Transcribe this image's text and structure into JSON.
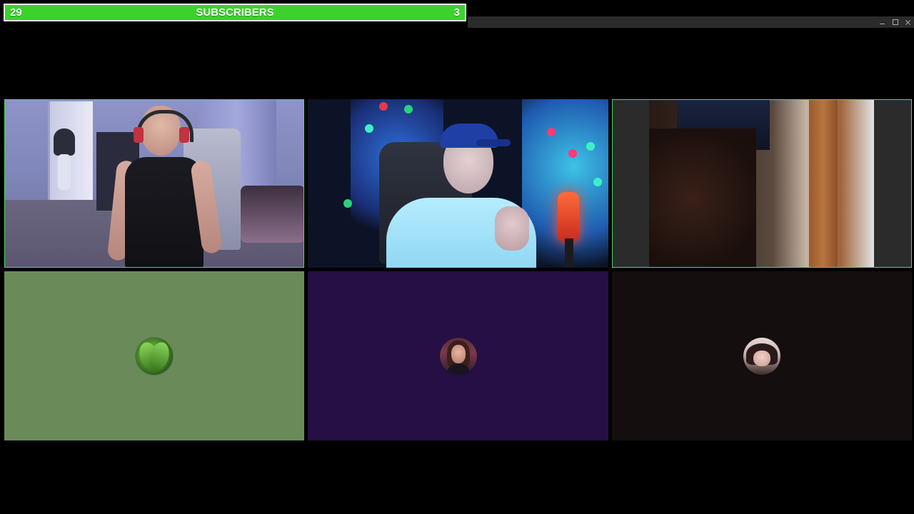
{
  "goal_bar": {
    "count_left": "29",
    "title": "SUBSCRIBERS",
    "count_right": "3",
    "color": "#3bd32b"
  },
  "window_controls": {
    "minimize_icon": "minimize-icon",
    "maximize_icon": "maximize-icon",
    "close_icon": "close-icon"
  },
  "tiles": [
    {
      "type": "video",
      "active": true,
      "speaker_border_color": "#4cd964"
    },
    {
      "type": "video",
      "active": false
    },
    {
      "type": "video",
      "active": true,
      "speaker_border_color": "#4cd964"
    },
    {
      "type": "avatar",
      "background": "#6b8a5a",
      "avatar_icon": "leaf-avatar-icon"
    },
    {
      "type": "avatar",
      "background": "#260f45",
      "avatar_icon": "user-avatar-icon"
    },
    {
      "type": "avatar",
      "background": "#140f0e",
      "avatar_icon": "user-avatar-icon"
    }
  ]
}
